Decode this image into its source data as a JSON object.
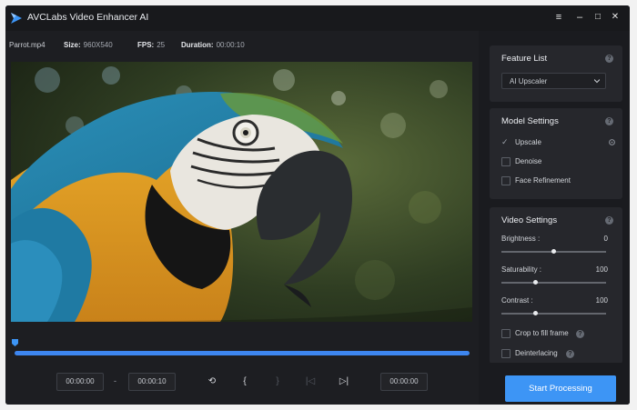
{
  "app": {
    "title": "AVCLabs Video Enhancer AI"
  },
  "window_controls": {
    "menu": "≡",
    "minimize": "–",
    "maximize": "□",
    "close": "✕"
  },
  "file_info": {
    "filename": "Parrot.mp4",
    "size_label": "Size:",
    "size_value": "960X540",
    "fps_label": "FPS:",
    "fps_value": "25",
    "duration_label": "Duration:",
    "duration_value": "00:00:10"
  },
  "timeline": {
    "start_time": "00:00:00",
    "separator": "-",
    "end_time": "00:00:10",
    "current_time": "00:00:00",
    "progress": 1.0,
    "buttons": {
      "restore": "⟲",
      "mark_in": "{",
      "mark_out": "}",
      "prev": "|◁",
      "next": "▷|"
    }
  },
  "feature_list": {
    "title": "Feature List",
    "help": "?",
    "selected": "AI Upscaler"
  },
  "model_settings": {
    "title": "Model Settings",
    "help": "?",
    "options": [
      {
        "label": "Upscale",
        "checked": true
      },
      {
        "label": "Denoise",
        "checked": false
      },
      {
        "label": "Face Refinement",
        "checked": false
      }
    ],
    "check_glyph": "✓"
  },
  "video_settings": {
    "title": "Video Settings",
    "help": "?",
    "sliders": [
      {
        "label": "Brightness :",
        "value": "0",
        "fraction": 0.5
      },
      {
        "label": "Saturability :",
        "value": "100",
        "fraction": 0.33
      },
      {
        "label": "Contrast :",
        "value": "100",
        "fraction": 0.33
      }
    ],
    "crop_label": "Crop to fill frame",
    "deinterlacing_label": "Deinterlacing"
  },
  "actions": {
    "start_label": "Start Processing"
  },
  "colors": {
    "accent": "#3d95f5",
    "background": "#1d1e22",
    "panel": "#26272c"
  }
}
